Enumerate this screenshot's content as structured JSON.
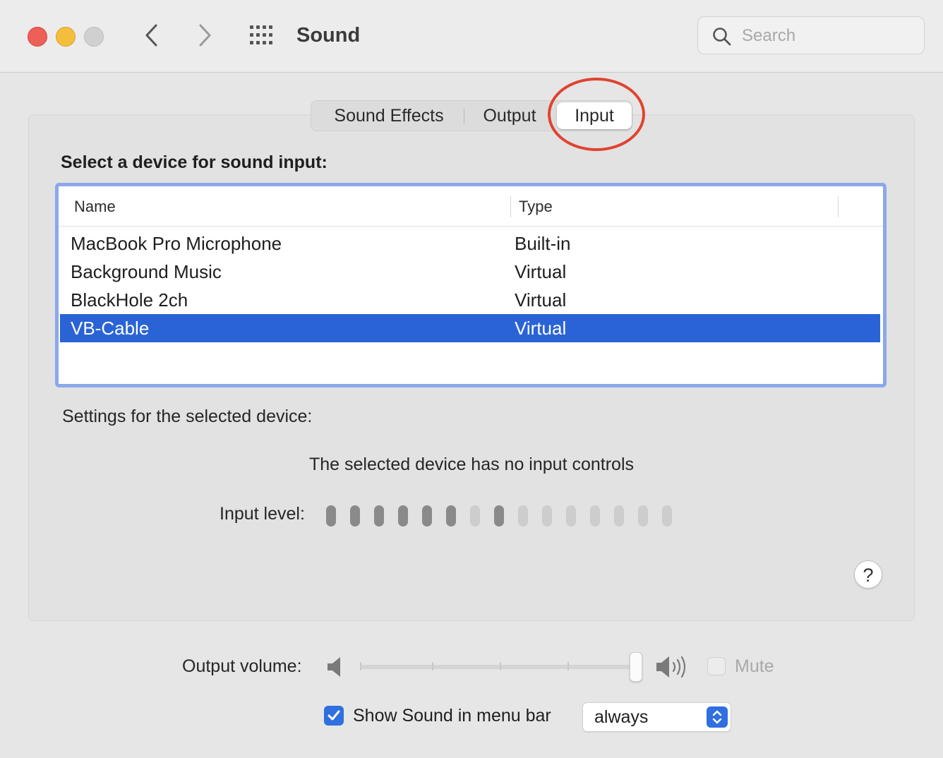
{
  "window": {
    "title": "Sound",
    "search_placeholder": "Search"
  },
  "tabs": [
    {
      "label": "Sound Effects",
      "selected": false
    },
    {
      "label": "Output",
      "selected": false
    },
    {
      "label": "Input",
      "selected": true
    }
  ],
  "input": {
    "heading": "Select a device for sound input:",
    "columns": {
      "name": "Name",
      "type": "Type"
    },
    "devices": [
      {
        "name": "MacBook Pro Microphone",
        "type": "Built-in",
        "selected": false
      },
      {
        "name": "Background Music",
        "type": "Virtual",
        "selected": false
      },
      {
        "name": "BlackHole 2ch",
        "type": "Virtual",
        "selected": false
      },
      {
        "name": "VB-Cable",
        "type": "Virtual",
        "selected": true
      }
    ],
    "settings_label": "Settings for the selected device:",
    "no_controls_message": "The selected device has no input controls",
    "input_level_label": "Input level:",
    "input_level_segments": [
      1,
      1,
      1,
      1,
      1,
      1,
      0,
      1,
      0,
      0,
      0,
      0,
      0,
      0,
      0
    ],
    "help_label": "?"
  },
  "footer": {
    "output_volume_label": "Output volume:",
    "output_volume": 1.0,
    "mute_label": "Mute",
    "mute_checked": false,
    "show_in_menu_bar_label": "Show Sound in menu bar",
    "show_in_menu_bar_checked": true,
    "menu_bar_option": "always"
  },
  "colors": {
    "selection": "#2a63d6",
    "accent": "#2f6fe0",
    "level_active": "#8a8a8a",
    "level_inactive": "#cdcdcd",
    "annotation": "#e0432f"
  },
  "icons": {
    "back": "chevron-left-icon",
    "forward": "chevron-right-icon",
    "show_all": "grid-icon",
    "search": "search-icon",
    "volume_low": "speaker-low-icon",
    "volume_high": "speaker-high-icon",
    "checkmark": "checkmark-icon",
    "stepper": "up-down-chevron-icon"
  }
}
